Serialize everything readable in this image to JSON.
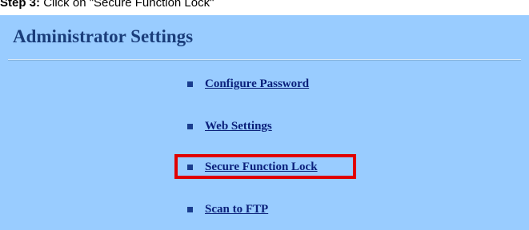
{
  "caption": {
    "step_label": "Step 3:",
    "instruction": "Click on \"Secure Function Lock\""
  },
  "panel": {
    "title": "Administrator Settings",
    "menu_items": [
      {
        "label": "Configure Password"
      },
      {
        "label": "Web Settings"
      },
      {
        "label": "Secure Function Lock",
        "highlighted": true
      },
      {
        "label": "Scan to FTP"
      }
    ]
  },
  "colors": {
    "panel_background": "#99ccff",
    "title_text": "#1a3d7a",
    "link_text": "#0a1f7a",
    "highlight_border": "#e00000"
  }
}
